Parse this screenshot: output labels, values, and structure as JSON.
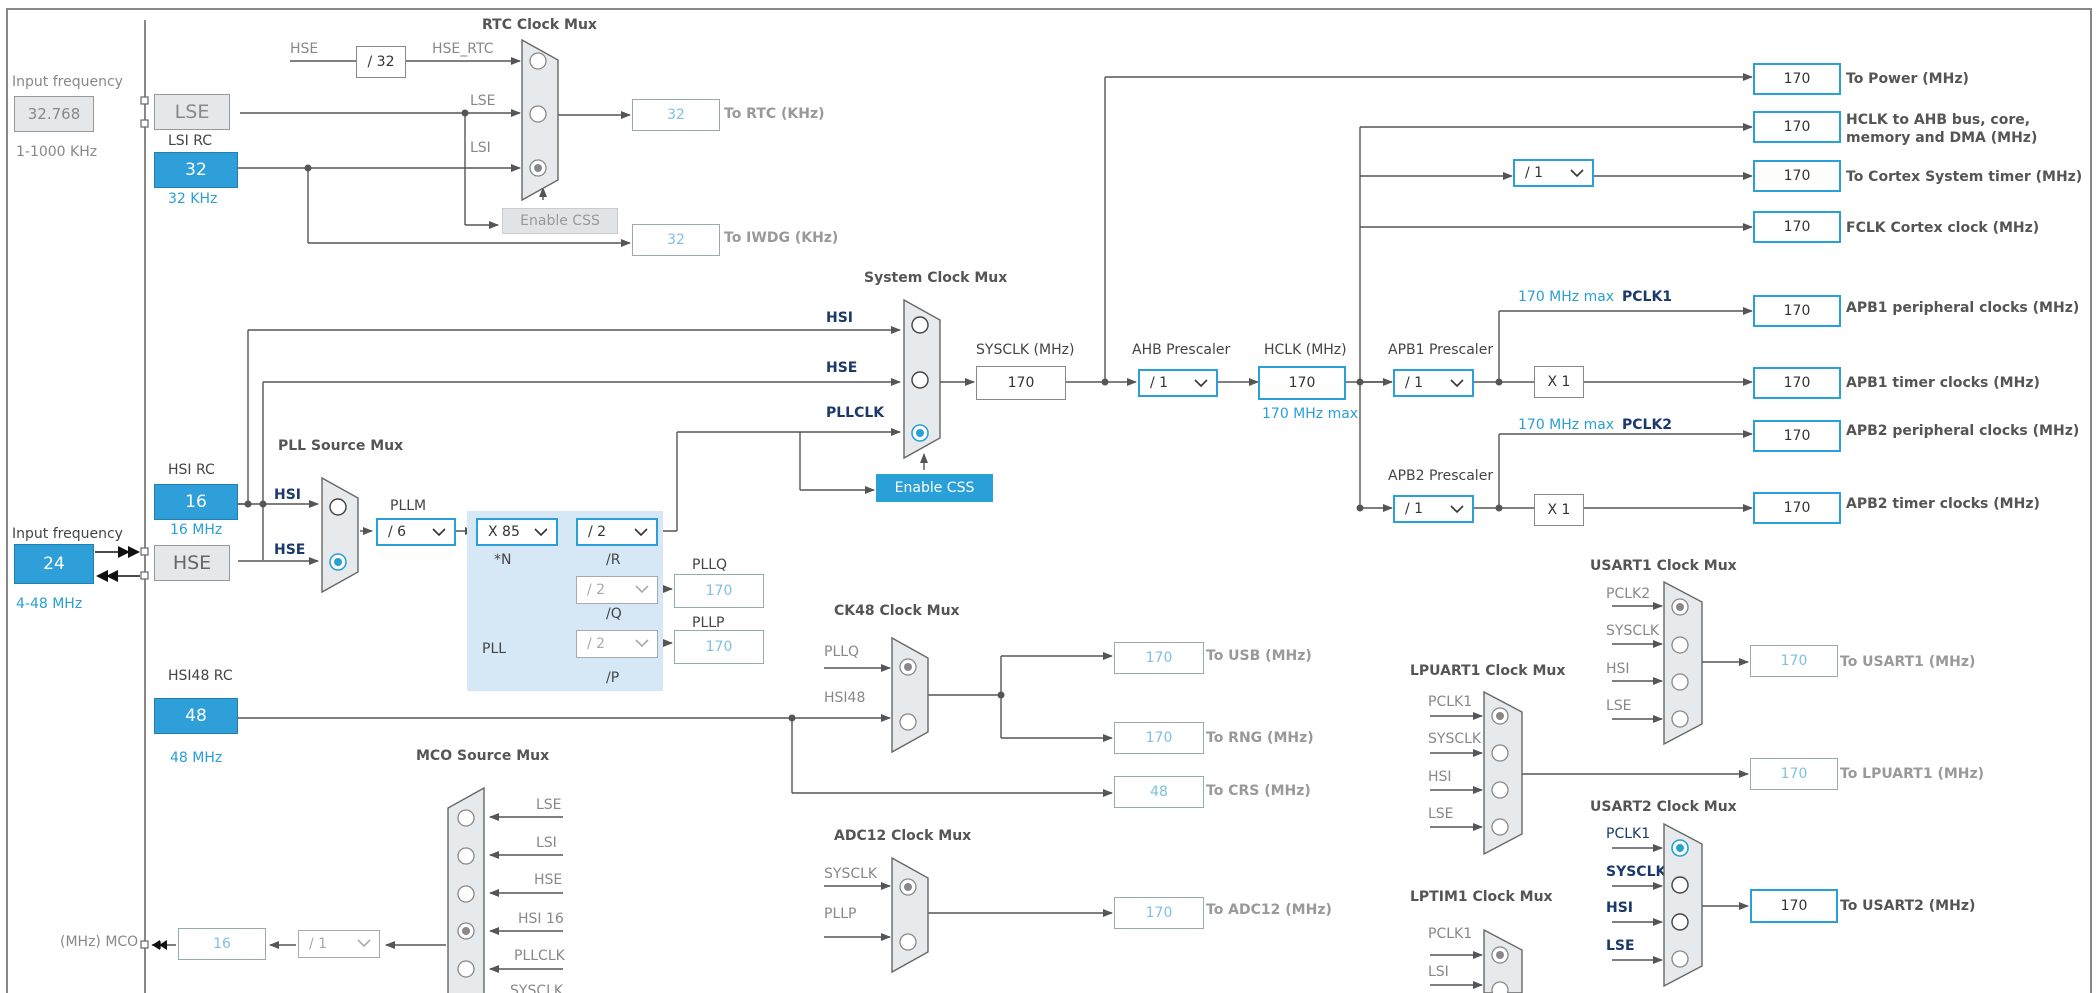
{
  "rtc_mux": {
    "title": "RTC Clock Mux",
    "hse_label": "HSE",
    "hse_div": "/ 32",
    "hse_rtc_label": "HSE_RTC",
    "lse_label": "LSE",
    "lsi_label": "LSI",
    "enable_css": "Enable CSS"
  },
  "lse": {
    "input_label": "Input frequency",
    "input_value": "32.768",
    "range": "1-1000 KHz",
    "box_label": "LSE"
  },
  "lsi": {
    "title": "LSI RC",
    "value": "32",
    "freq": "32 KHz"
  },
  "rtc_out": {
    "value": "32",
    "label": "To RTC (KHz)"
  },
  "iwdg_out": {
    "value": "32",
    "label": "To IWDG (KHz)"
  },
  "sysclk_mux": {
    "title": "System Clock Mux",
    "hsi_label": "HSI",
    "hse_label": "HSE",
    "pllclk_label": "PLLCLK",
    "enable_css": "Enable CSS"
  },
  "sysclk": {
    "label": "SYSCLK (MHz)",
    "value": "170"
  },
  "ahb": {
    "label": "AHB Prescaler",
    "value": "/ 1"
  },
  "hclk": {
    "label": "HCLK (MHz)",
    "value": "170",
    "max": "170 MHz max"
  },
  "apb1": {
    "label": "APB1 Prescaler",
    "value": "/ 1",
    "max": "170 MHz max",
    "pclk": "PCLK1",
    "mult": "X 1"
  },
  "apb2": {
    "label": "APB2 Prescaler",
    "value": "/ 1",
    "max": "170 MHz max",
    "pclk": "PCLK2",
    "mult": "X 1"
  },
  "cortex_div": "/ 1",
  "outputs": [
    {
      "value": "170",
      "label": "To Power (MHz)"
    },
    {
      "value": "170",
      "label": "HCLK to AHB bus, core,",
      "label2": "memory and DMA (MHz)"
    },
    {
      "value": "170",
      "label": "To Cortex System timer (MHz)"
    },
    {
      "value": "170",
      "label": "FCLK Cortex clock (MHz)"
    },
    {
      "value": "170",
      "label": "APB1 peripheral clocks (MHz)"
    },
    {
      "value": "170",
      "label": "APB1 timer clocks (MHz)"
    },
    {
      "value": "170",
      "label": "APB2 peripheral clocks (MHz)"
    },
    {
      "value": "170",
      "label": "APB2 timer clocks (MHz)"
    }
  ],
  "hsi": {
    "title": "HSI RC",
    "value": "16",
    "freq": "16 MHz"
  },
  "hse": {
    "input_label": "Input frequency",
    "input_value": "24",
    "range": "4-48 MHz",
    "box_label": "HSE"
  },
  "pll_src_mux": {
    "title": "PLL Source Mux",
    "hsi_label": "HSI",
    "hse_label": "HSE"
  },
  "pll": {
    "pllm_label": "PLLM",
    "pllm_value": "/ 6",
    "n_value": "X 85",
    "n_label": "*N",
    "r_value": "/ 2",
    "r_label": "/R",
    "q_value": "/ 2",
    "q_label": "/Q",
    "p_value": "/ 2",
    "p_label": "/P",
    "pll_label": "PLL",
    "pllq_label": "PLLQ",
    "pllq_value": "170",
    "pllp_label": "PLLP",
    "pllp_value": "170"
  },
  "hsi48": {
    "title": "HSI48 RC",
    "value": "48",
    "freq": "48 MHz"
  },
  "ck48_mux": {
    "title": "CK48 Clock Mux",
    "pllq_label": "PLLQ",
    "hsi48_label": "HSI48"
  },
  "usb_out": {
    "value": "170",
    "label": "To USB (MHz)"
  },
  "rng_out": {
    "value": "170",
    "label": "To RNG (MHz)"
  },
  "crs_out": {
    "value": "48",
    "label": "To CRS (MHz)"
  },
  "adc_mux": {
    "title": "ADC12 Clock Mux",
    "sysclk_label": "SYSCLK",
    "pllp_label": "PLLP"
  },
  "adc_out": {
    "value": "170",
    "label": "To ADC12 (MHz)"
  },
  "mco_mux": {
    "title": "MCO Source Mux",
    "inputs": [
      "LSE",
      "LSI",
      "HSE",
      "HSI 16",
      "PLLCLK",
      "SYSCLK"
    ]
  },
  "mco": {
    "label": "(MHz) MCO",
    "value": "16",
    "div": "/ 1"
  },
  "usart1_mux": {
    "title": "USART1 Clock Mux",
    "inputs": [
      "PCLK2",
      "SYSCLK",
      "HSI",
      "LSE"
    ]
  },
  "usart1_out": {
    "value": "170",
    "label": "To USART1 (MHz)"
  },
  "lpuart1_mux": {
    "title": "LPUART1 Clock Mux",
    "inputs": [
      "PCLK1",
      "SYSCLK",
      "HSI",
      "LSE"
    ]
  },
  "lpuart1_out": {
    "value": "170",
    "label": "To LPUART1 (MHz)"
  },
  "usart2_mux": {
    "title": "USART2 Clock Mux",
    "inputs": [
      "PCLK1",
      "SYSCLK",
      "HSI",
      "LSE"
    ]
  },
  "usart2_out": {
    "value": "170",
    "label": "To USART2 (MHz)"
  },
  "lptim1_mux": {
    "title": "LPTIM1 Clock Mux",
    "inputs": [
      "PCLK1",
      "LSI"
    ]
  },
  "colors": {
    "accent": "#2aa0d8",
    "source_fill": "#2e9fd9",
    "pll_bg": "#d6e8f6",
    "wire": "#555555"
  }
}
